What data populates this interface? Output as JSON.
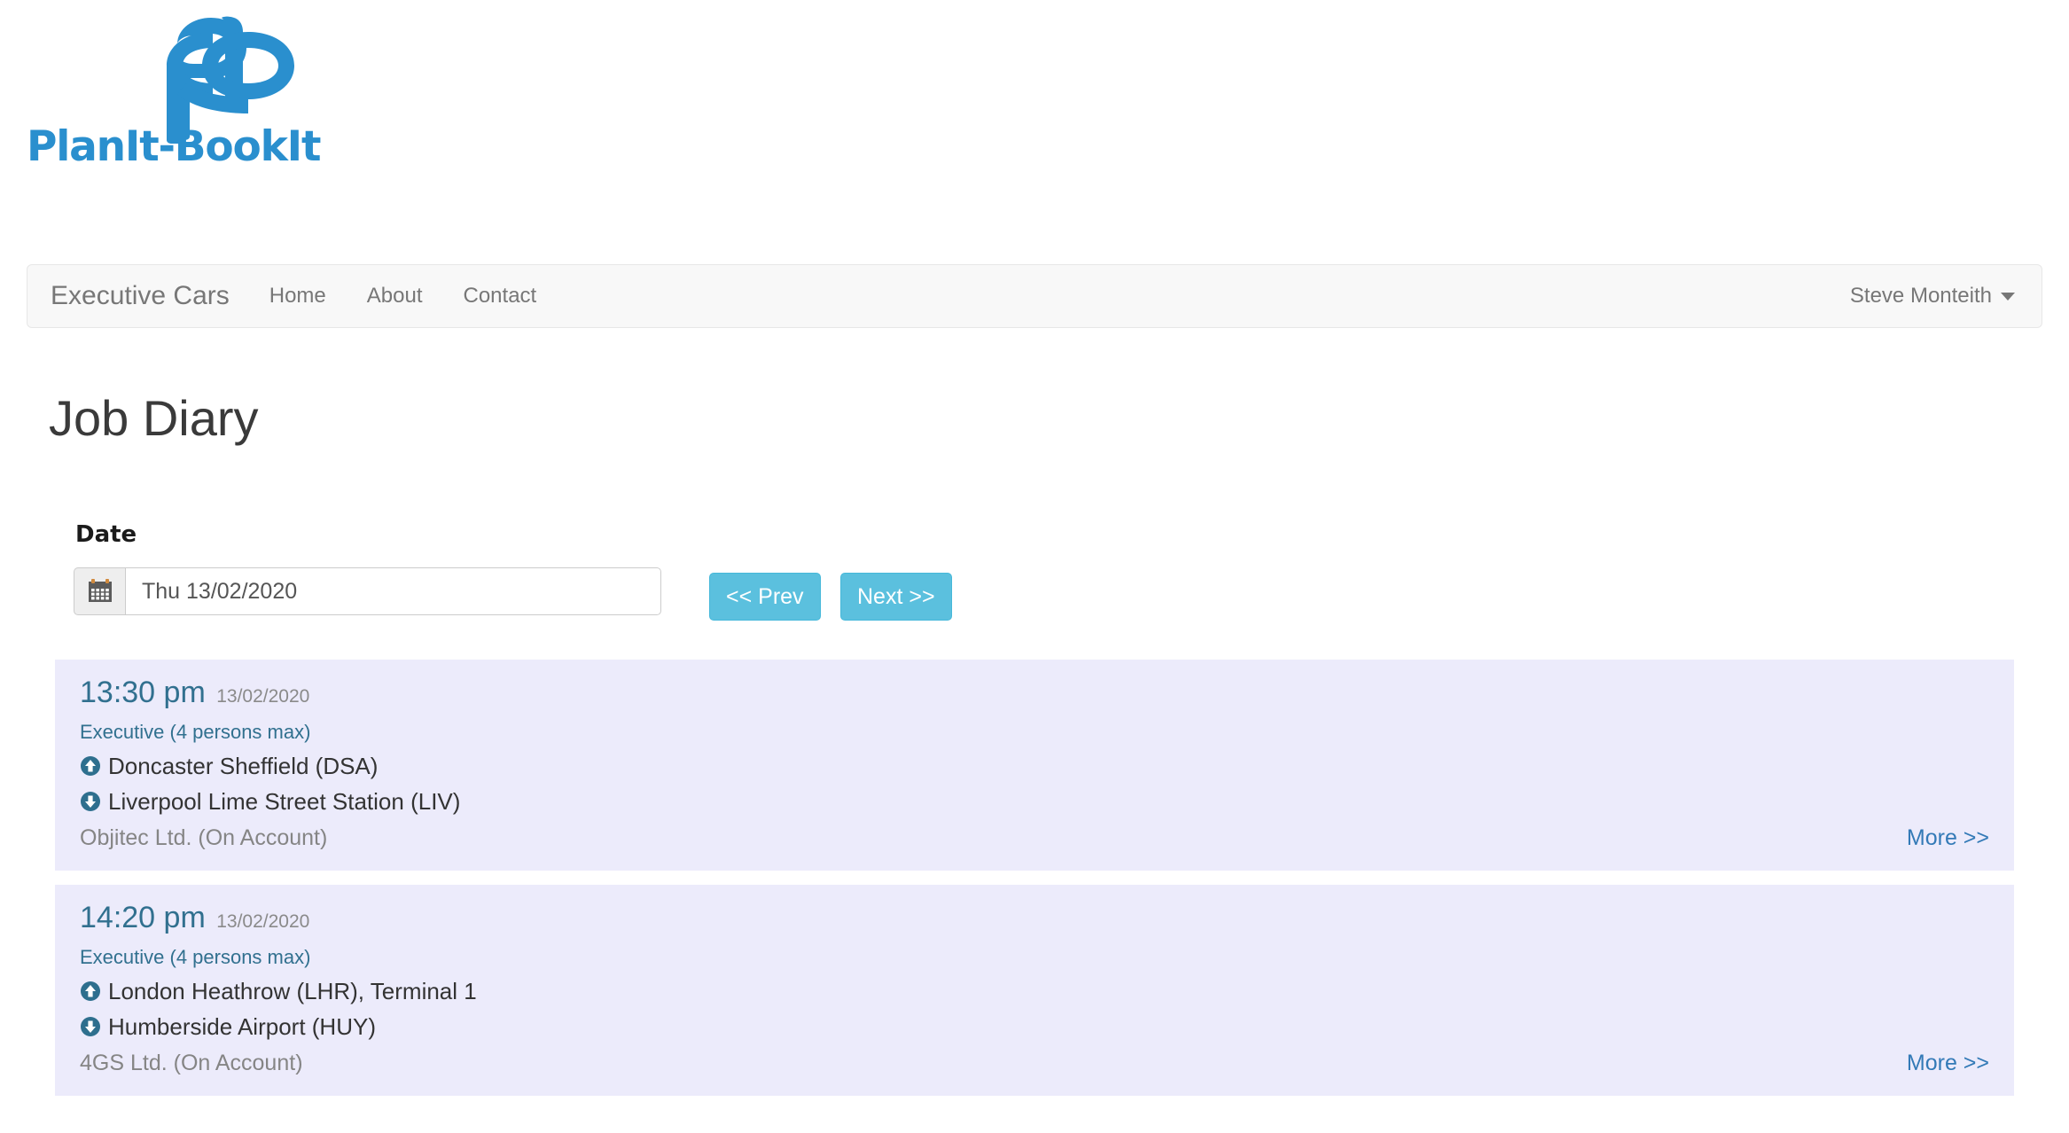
{
  "brand": {
    "logo_text": "PlanIt-BookIt",
    "logo_color": "#2a8fce"
  },
  "navbar": {
    "brand": "Executive Cars",
    "links": [
      {
        "label": "Home"
      },
      {
        "label": "About"
      },
      {
        "label": "Contact"
      }
    ],
    "user": "Steve Monteith"
  },
  "page": {
    "title": "Job Diary"
  },
  "date_form": {
    "label": "Date",
    "icon": "calendar-icon",
    "value": "Thu 13/02/2020",
    "placeholder": "Thu 13/02/2020",
    "prev_label": "<< Prev",
    "next_label": "Next >>",
    "button_color": "#5bc0de"
  },
  "jobs": [
    {
      "time": "13:30 pm",
      "date": "13/02/2020",
      "vehicle": "Executive (4 persons max)",
      "pickup": "Doncaster Sheffield (DSA)",
      "dropoff": "Liverpool Lime Street Station (LIV)",
      "client": "Objitec Ltd. (On Account)",
      "more_label": "More >>"
    },
    {
      "time": "14:20 pm",
      "date": "13/02/2020",
      "vehicle": "Executive (4 persons max)",
      "pickup": "London Heathrow (LHR), Terminal 1",
      "dropoff": "Humberside Airport (HUY)",
      "client": "4GS Ltd. (On Account)",
      "more_label": "More >>"
    }
  ],
  "colors": {
    "card_background": "#ecebfb",
    "accent": "#31708f",
    "link": "#337ab7"
  }
}
